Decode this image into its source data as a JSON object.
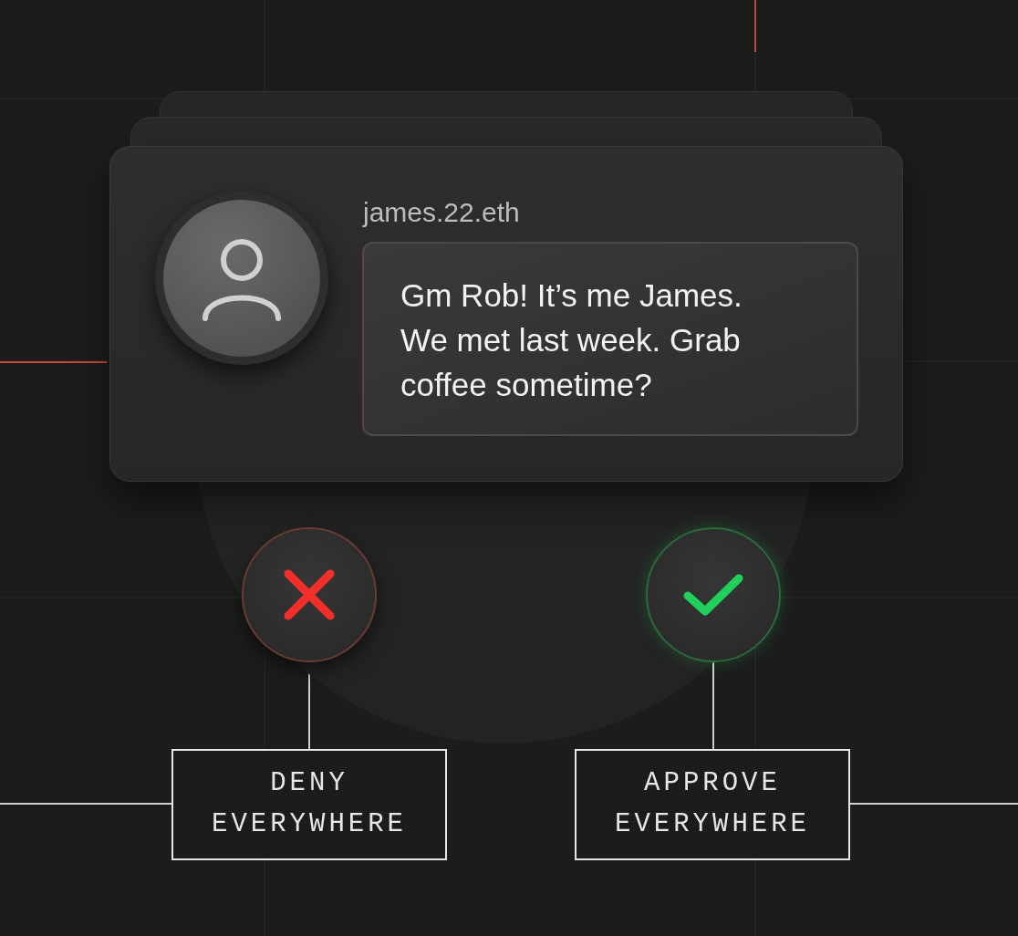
{
  "message_card": {
    "username": "james.22.eth",
    "message": "Gm Rob! It’s me James. We met last week. Grab coffee sometime?"
  },
  "actions": [
    {
      "kind": "deny",
      "label": "DENY EVERYWHERE"
    },
    {
      "kind": "approve",
      "label": "APPROVE EVERYWHERE"
    }
  ]
}
